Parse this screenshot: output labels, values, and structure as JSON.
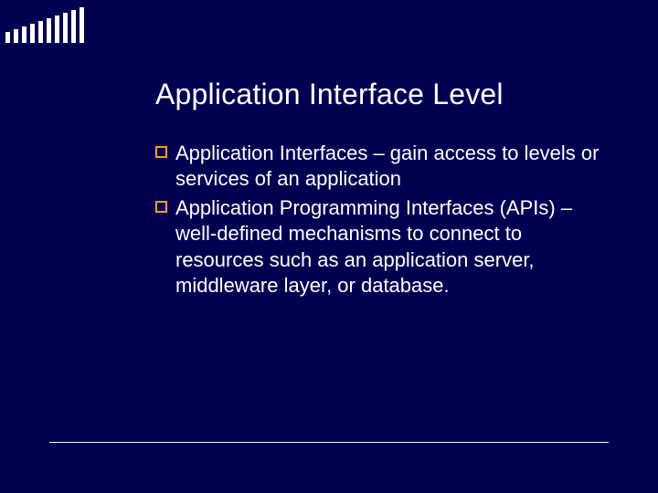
{
  "title": "Application Interface Level",
  "bullets": [
    "Application Interfaces – gain access to levels or services of an application",
    "Application Programming Interfaces (APIs) –well-defined mechanisms to connect to resources such as an application server, middleware layer, or database."
  ]
}
